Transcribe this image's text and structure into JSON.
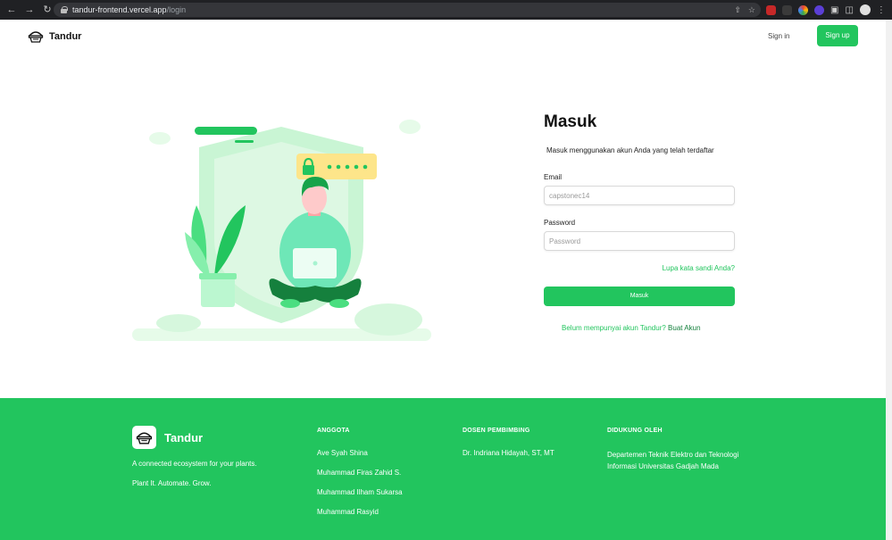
{
  "browser": {
    "url_host": "tandur-frontend.vercel.app",
    "url_path": "/login",
    "back_icon": "arrow-left-icon",
    "forward_icon": "arrow-right-icon",
    "reload_icon": "reload-icon"
  },
  "header": {
    "brand": "Tandur",
    "signin": "Sign in",
    "signup": "Sign up",
    "accent": "#22c55e"
  },
  "login": {
    "title": "Masuk",
    "subtitle": "Masuk menggunakan akun Anda yang telah terdaftar",
    "email_label": "Email",
    "email_value": "capstonec14",
    "password_label": "Password",
    "password_placeholder": "Password",
    "forgot": "Lupa kata sandi Anda?",
    "submit": "Masuk",
    "register_question": "Belum mempunyai akun Tandur?",
    "register_link": "Buat Akun"
  },
  "footer": {
    "brand": "Tandur",
    "tagline": "A connected ecosystem for your plants.",
    "motto": "Plant It. Automate. Grow.",
    "members_title": "ANGGOTA",
    "members": [
      "Ave Syah Shina",
      "Muhammad Firas Zahid S.",
      "Muhammad Ilham Sukarsa",
      "Muhammad Rasyid"
    ],
    "advisor_title": "DOSEN PEMBIMBING",
    "advisor": "Dr. Indriana Hidayah, ST, MT",
    "supported_title": "DIDUKUNG OLEH",
    "supported_by": "Departemen Teknik Elektro dan Teknologi Informasi Universitas Gadjah Mada"
  }
}
